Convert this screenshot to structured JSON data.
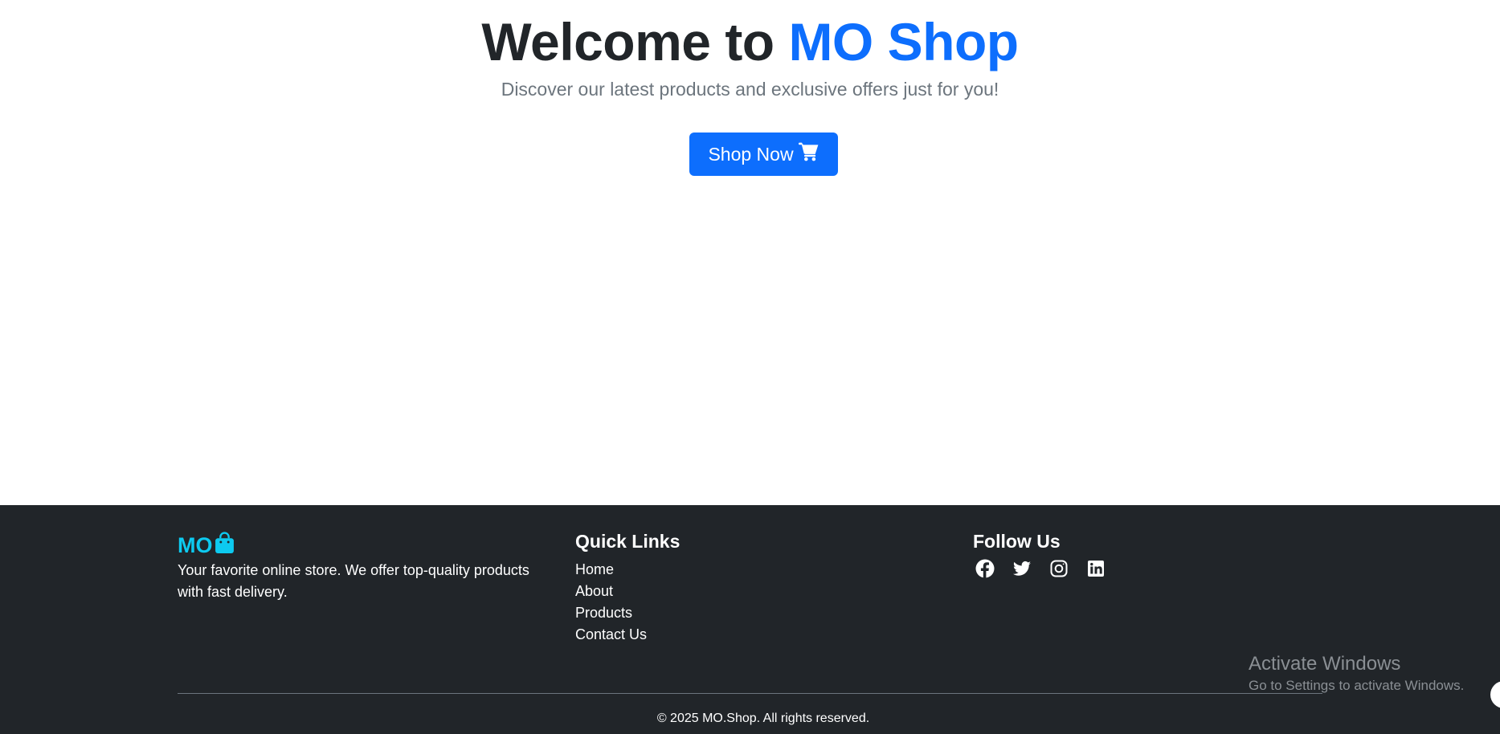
{
  "hero": {
    "title_prefix": "Welcome to ",
    "title_brand": "MO Shop",
    "subtitle": "Discover our latest products and exclusive offers just for you!",
    "cta_label": "Shop Now",
    "cta_icon": "cart-icon"
  },
  "footer": {
    "logo_text": "MO",
    "logo_icon": "shopping-bag-icon",
    "description": "Your favorite online store. We offer top-quality products with fast delivery.",
    "quick_links": {
      "title": "Quick Links",
      "items": [
        "Home",
        "About",
        "Products",
        "Contact Us"
      ]
    },
    "follow": {
      "title": "Follow Us",
      "icons": [
        "facebook-icon",
        "twitter-icon",
        "instagram-icon",
        "linkedin-icon"
      ]
    },
    "copyright": "© 2025 MO.Shop. All rights reserved."
  },
  "overlay": {
    "activate_title": "Activate Windows",
    "activate_sub": "Go to Settings to activate Windows."
  },
  "colors": {
    "primary": "#0d6efd",
    "brand_cyan": "#0dcaf0",
    "footer_bg": "#212529",
    "heading": "#212529",
    "muted": "#6c757d"
  }
}
